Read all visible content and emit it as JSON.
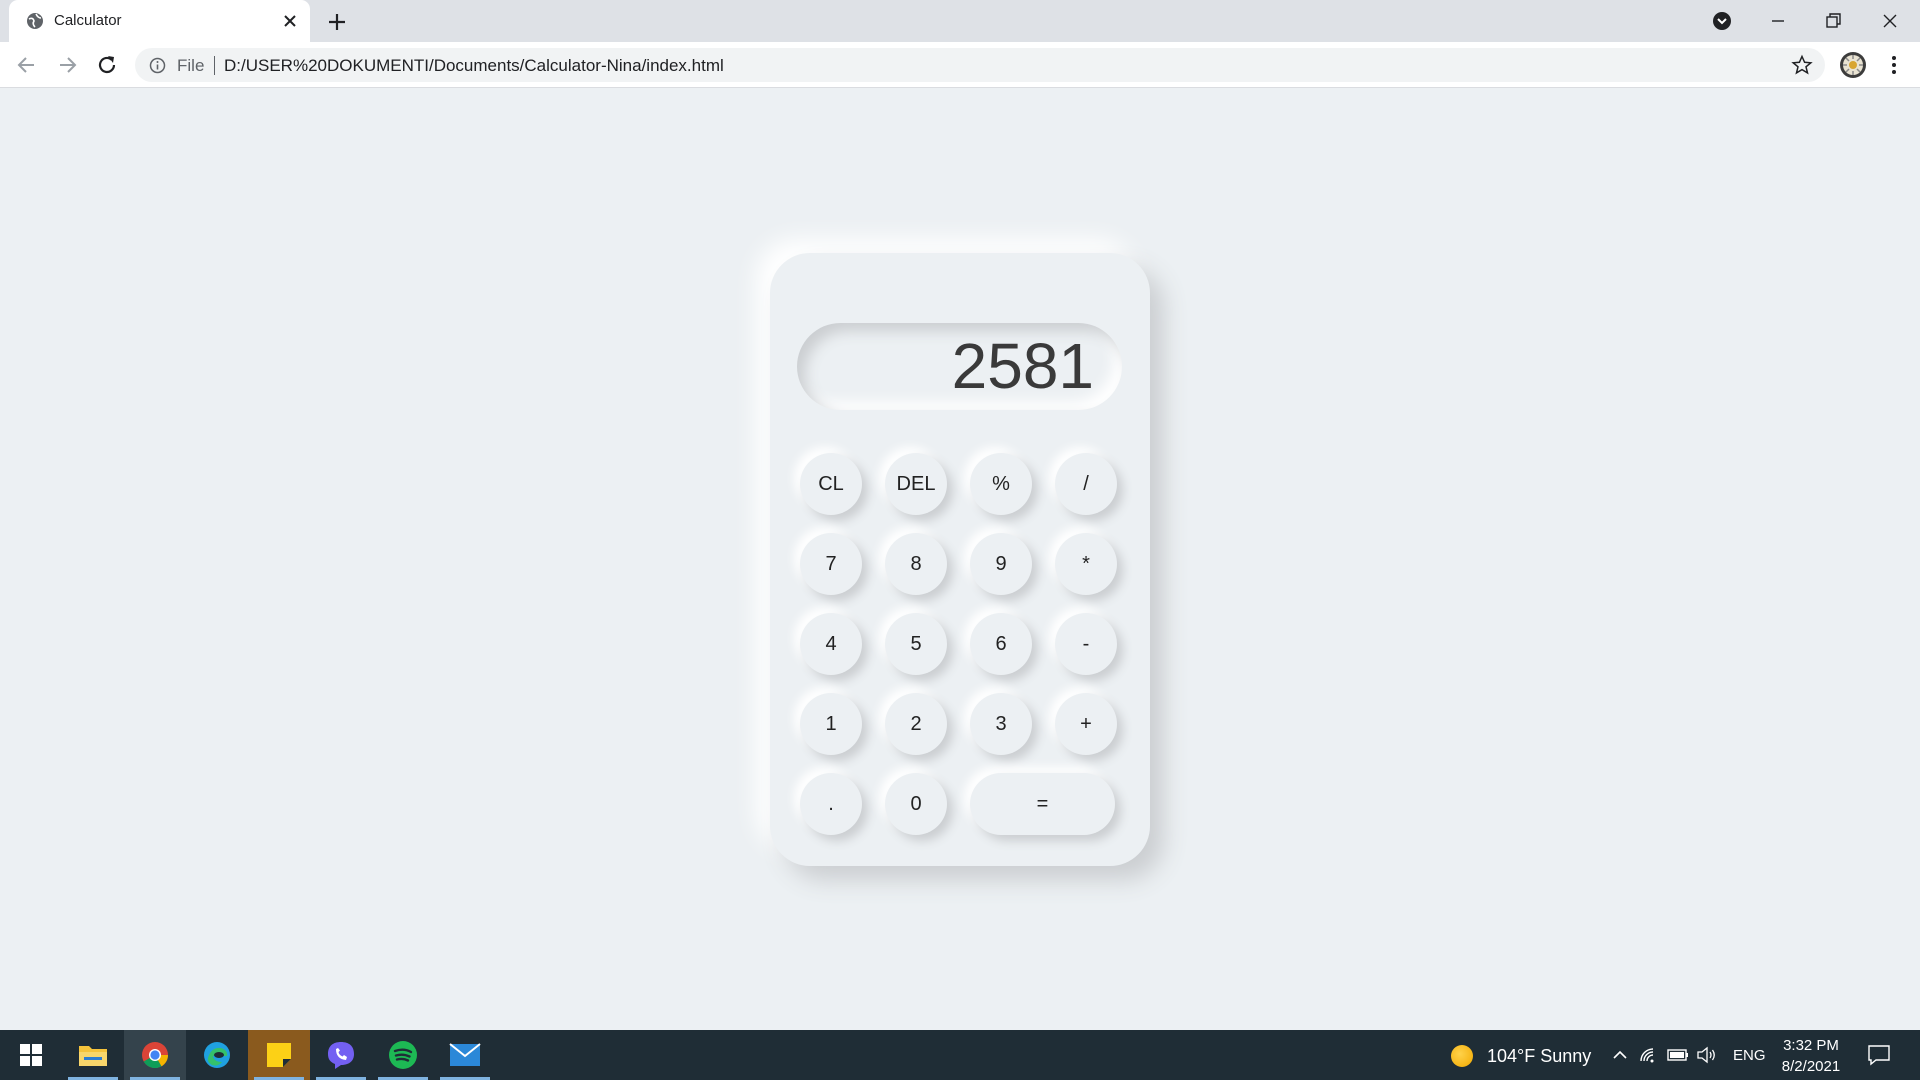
{
  "browser": {
    "tab_title": "Calculator",
    "scheme_label": "File",
    "url": "D:/USER%20DOKUMENTI/Documents/Calculator-Nina/index.html"
  },
  "calculator": {
    "display": "2581",
    "keys": {
      "cl": "CL",
      "del": "DEL",
      "percent": "%",
      "divide": "/",
      "seven": "7",
      "eight": "8",
      "nine": "9",
      "multiply": "*",
      "four": "4",
      "five": "5",
      "six": "6",
      "minus": "-",
      "one": "1",
      "two": "2",
      "three": "3",
      "plus": "+",
      "dot": ".",
      "zero": "0",
      "equals": "="
    }
  },
  "taskbar": {
    "weather": "104°F  Sunny",
    "language": "ENG",
    "time": "3:32 PM",
    "date": "8/2/2021",
    "apps": [
      "file-explorer",
      "chrome",
      "edge",
      "sticky-notes",
      "viber",
      "spotify",
      "mail"
    ]
  },
  "colors": {
    "page_bg": "#ecf0f3",
    "taskbar_bg": "#1f2d36",
    "display_text": "#3a3a3a"
  }
}
